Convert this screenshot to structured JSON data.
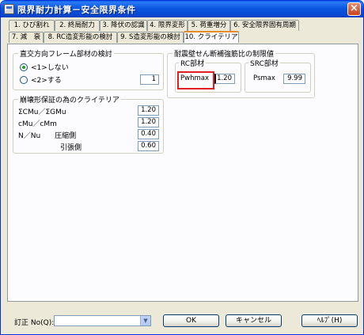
{
  "window": {
    "title": "限界耐力計算－安全限界条件"
  },
  "tabs_row1": [
    "1. ひび割れ",
    "2. 終局耐力",
    "3. 降伏の認識",
    "4. 限界変形",
    "5. 荷重増分",
    "6. 安全限界固有周期"
  ],
  "tabs_row2": [
    "7. 減　衰",
    "8. RC造変形能の検討",
    "9. S造変形能の検討",
    "10. クライテリア"
  ],
  "active_tab": "10. クライテリア",
  "group_frame": {
    "title": "直交方向フレーム部材の検討",
    "option1": "<1>しない",
    "option2": "<2>する",
    "option1_checked": true,
    "value": "1"
  },
  "group_collapse": {
    "title": "崩壊形保証の為のクライテリア",
    "rows": [
      {
        "label": "ΣCMu／ΣGMu",
        "value": "1.20"
      },
      {
        "label": "cMu／cMm",
        "value": "1.20"
      },
      {
        "label": "N／Nu　　圧縮側",
        "value": "0.40"
      },
      {
        "label": "引張側",
        "value": "0.60"
      }
    ]
  },
  "group_wall": {
    "title": "耐震壁せん断補強筋比の制限値",
    "rc_title": "RC部材",
    "rc_label": "Pwhmax",
    "rc_value": "1.20",
    "src_title": "SRC部材",
    "src_label": "Psmax",
    "src_value": "9.99"
  },
  "footer": {
    "revision_label": "訂正 No(Q):",
    "revision_value": "",
    "ok_label": "OK",
    "cancel_label": "キャンセル",
    "help_label": "ﾍﾙﾌﾟ(H)"
  },
  "colors": {
    "title_bar": "#0b57e0",
    "highlight": "#e02020",
    "active_tab_accent": "#e68b2c"
  }
}
